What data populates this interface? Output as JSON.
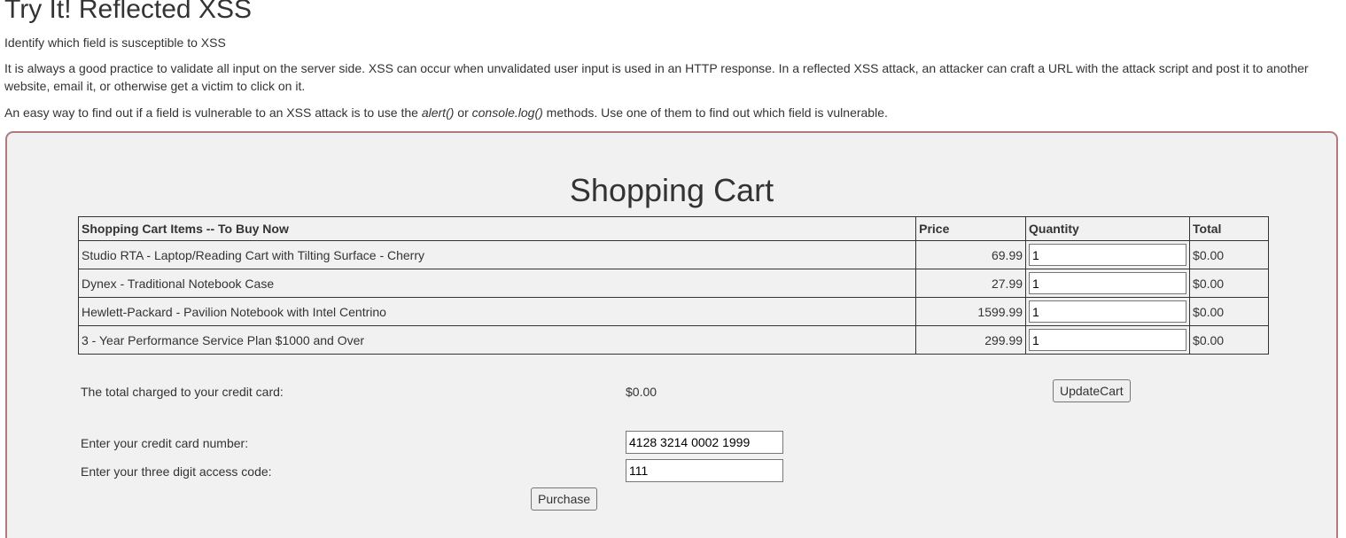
{
  "header": {
    "title": "Try It! Reflected XSS",
    "subtitle": "Identify which field is susceptible to XSS",
    "paragraph1": "It is always a good practice to validate all input on the server side. XSS can occur when unvalidated user input is used in an HTTP response. In a reflected XSS attack, an attacker can craft a URL with the attack script and post it to another website, email it, or otherwise get a victim to click on it.",
    "paragraph2_start": "An easy way to find out if a field is vulnerable to an XSS attack is to use the ",
    "paragraph2_alert": "alert()",
    "paragraph2_or": " or ",
    "paragraph2_console": "console.log()",
    "paragraph2_end": " methods. Use one of them to find out which field is vulnerable."
  },
  "cart": {
    "title": "Shopping Cart",
    "columns": {
      "item": "Shopping Cart Items -- To Buy Now",
      "price": "Price",
      "quantity": "Quantity",
      "total": "Total"
    },
    "rows": [
      {
        "item": "Studio RTA - Laptop/Reading Cart with Tilting Surface - Cherry",
        "price": "69.99",
        "quantity": "1",
        "total": "$0.00"
      },
      {
        "item": "Dynex - Traditional Notebook Case",
        "price": "27.99",
        "quantity": "1",
        "total": "$0.00"
      },
      {
        "item": "Hewlett-Packard - Pavilion Notebook with Intel Centrino",
        "price": "1599.99",
        "quantity": "1",
        "total": "$0.00"
      },
      {
        "item": "3 - Year Performance Service Plan $1000 and Over",
        "price": "299.99",
        "quantity": "1",
        "total": "$0.00"
      }
    ]
  },
  "checkout": {
    "total_label": "The total charged to your credit card:",
    "total_value": "$0.00",
    "update_button": "UpdateCart",
    "cc_label": "Enter your credit card number:",
    "cc_value": "4128 3214 0002 1999",
    "code_label": "Enter your three digit access code:",
    "code_value": "111",
    "purchase_button": "Purchase"
  },
  "colors": {
    "panel_background": "#f1f1f1",
    "panel_border": "#b27a7a",
    "text": "#333333"
  }
}
